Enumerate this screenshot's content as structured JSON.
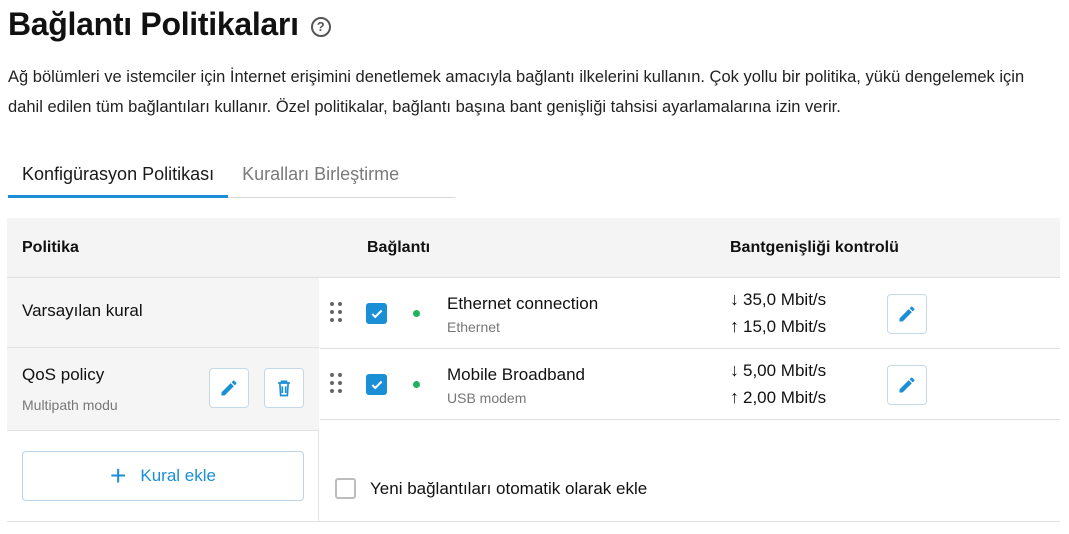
{
  "header": {
    "title": "Bağlantı Politikaları",
    "help_glyph": "?",
    "description": "Ağ bölümleri ve istemciler için İnternet erişimini denetlemek amacıyla bağlantı ilkelerini kullanın. Çok yollu bir politika, yükü dengelemek için dahil edilen tüm bağlantıları kullanır. Özel politikalar, bağlantı başına bant genişliği tahsisi ayarlamalarına izin verir."
  },
  "tabs": [
    {
      "label": "Konfigürasyon Politikası",
      "active": true
    },
    {
      "label": "Kuralları Birleştirme",
      "active": false
    }
  ],
  "table": {
    "headers": {
      "policy": "Politika",
      "connection": "Bağlantı",
      "bandwidth": "Bantgenişliği kontrolü"
    },
    "policies": [
      {
        "name": "Varsayılan kural",
        "subtitle": ""
      },
      {
        "name": "QoS policy",
        "subtitle": "Multipath modu"
      }
    ],
    "connections": [
      {
        "name": "Ethernet connection",
        "type": "Ethernet",
        "down": "35,0 Mbit/s",
        "up": "15,0 Mbit/s",
        "checked": true,
        "status_color": "#1fb45a"
      },
      {
        "name": "Mobile Broadband",
        "type": "USB modem",
        "down": "5,00 Mbit/s",
        "up": "2,00 Mbit/s",
        "checked": true,
        "status_color": "#1fb45a"
      }
    ],
    "add_rule_label": "Kural ekle",
    "add_rule_glyph": "+",
    "auto_add_label": "Yeni bağlantıları otomatik olarak ekle",
    "auto_add_checked": false
  },
  "glyphs": {
    "down_arrow": "↓",
    "up_arrow": "↑"
  },
  "colors": {
    "accent": "#1a8fd6",
    "status_online": "#1fb45a"
  }
}
